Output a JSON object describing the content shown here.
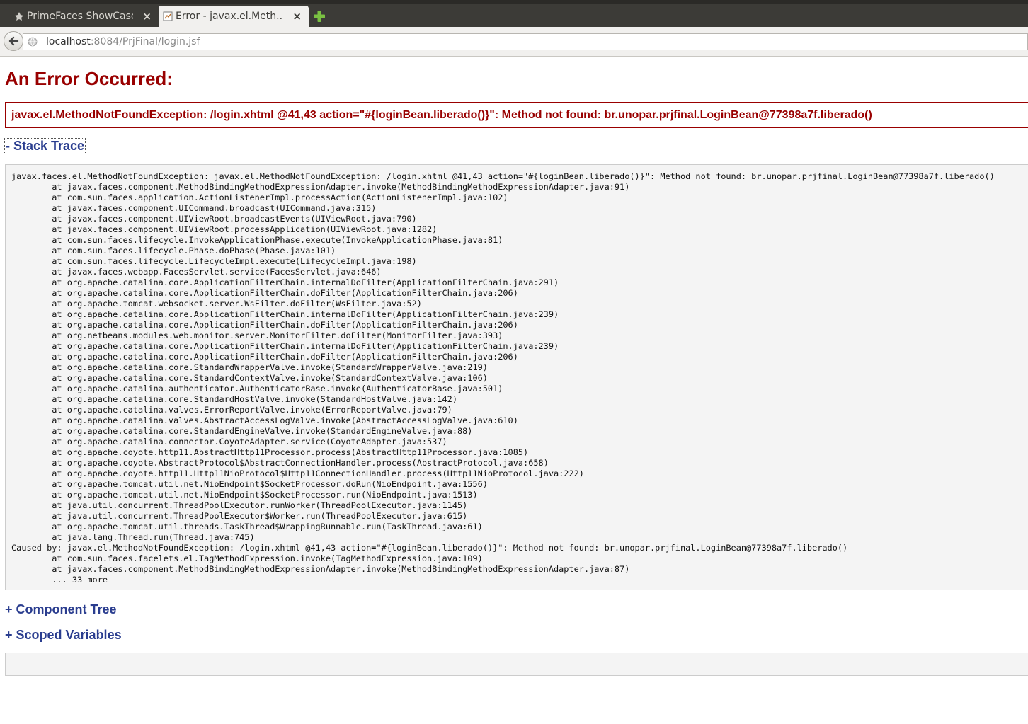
{
  "browser": {
    "tabs": [
      {
        "title": "PrimeFaces ShowCase",
        "close": "×",
        "favicon": "primefaces-icon"
      },
      {
        "title": "Error - javax.el.Meth...",
        "close": "×",
        "favicon": "page-icon"
      }
    ],
    "new_tab_icon": "plus-icon",
    "address": {
      "host": "localhost",
      "rest": ":8084/PrjFinal/login.jsf"
    }
  },
  "page": {
    "heading": "An Error Occurred:",
    "error_message": "javax.el.MethodNotFoundException: /login.xhtml @41,43 action=\"#{loginBean.liberado()}\": Method not found: br.unopar.prjfinal.LoginBean@77398a7f.liberado()",
    "stack_trace_toggle": "- Stack Trace",
    "stack_trace_lines": [
      "javax.faces.el.MethodNotFoundException: javax.el.MethodNotFoundException: /login.xhtml @41,43 action=\"#{loginBean.liberado()}\": Method not found: br.unopar.prjfinal.LoginBean@77398a7f.liberado()",
      "\tat javax.faces.component.MethodBindingMethodExpressionAdapter.invoke(MethodBindingMethodExpressionAdapter.java:91)",
      "\tat com.sun.faces.application.ActionListenerImpl.processAction(ActionListenerImpl.java:102)",
      "\tat javax.faces.component.UICommand.broadcast(UICommand.java:315)",
      "\tat javax.faces.component.UIViewRoot.broadcastEvents(UIViewRoot.java:790)",
      "\tat javax.faces.component.UIViewRoot.processApplication(UIViewRoot.java:1282)",
      "\tat com.sun.faces.lifecycle.InvokeApplicationPhase.execute(InvokeApplicationPhase.java:81)",
      "\tat com.sun.faces.lifecycle.Phase.doPhase(Phase.java:101)",
      "\tat com.sun.faces.lifecycle.LifecycleImpl.execute(LifecycleImpl.java:198)",
      "\tat javax.faces.webapp.FacesServlet.service(FacesServlet.java:646)",
      "\tat org.apache.catalina.core.ApplicationFilterChain.internalDoFilter(ApplicationFilterChain.java:291)",
      "\tat org.apache.catalina.core.ApplicationFilterChain.doFilter(ApplicationFilterChain.java:206)",
      "\tat org.apache.tomcat.websocket.server.WsFilter.doFilter(WsFilter.java:52)",
      "\tat org.apache.catalina.core.ApplicationFilterChain.internalDoFilter(ApplicationFilterChain.java:239)",
      "\tat org.apache.catalina.core.ApplicationFilterChain.doFilter(ApplicationFilterChain.java:206)",
      "\tat org.netbeans.modules.web.monitor.server.MonitorFilter.doFilter(MonitorFilter.java:393)",
      "\tat org.apache.catalina.core.ApplicationFilterChain.internalDoFilter(ApplicationFilterChain.java:239)",
      "\tat org.apache.catalina.core.ApplicationFilterChain.doFilter(ApplicationFilterChain.java:206)",
      "\tat org.apache.catalina.core.StandardWrapperValve.invoke(StandardWrapperValve.java:219)",
      "\tat org.apache.catalina.core.StandardContextValve.invoke(StandardContextValve.java:106)",
      "\tat org.apache.catalina.authenticator.AuthenticatorBase.invoke(AuthenticatorBase.java:501)",
      "\tat org.apache.catalina.core.StandardHostValve.invoke(StandardHostValve.java:142)",
      "\tat org.apache.catalina.valves.ErrorReportValve.invoke(ErrorReportValve.java:79)",
      "\tat org.apache.catalina.valves.AbstractAccessLogValve.invoke(AbstractAccessLogValve.java:610)",
      "\tat org.apache.catalina.core.StandardEngineValve.invoke(StandardEngineValve.java:88)",
      "\tat org.apache.catalina.connector.CoyoteAdapter.service(CoyoteAdapter.java:537)",
      "\tat org.apache.coyote.http11.AbstractHttp11Processor.process(AbstractHttp11Processor.java:1085)",
      "\tat org.apache.coyote.AbstractProtocol$AbstractConnectionHandler.process(AbstractProtocol.java:658)",
      "\tat org.apache.coyote.http11.Http11NioProtocol$Http11ConnectionHandler.process(Http11NioProtocol.java:222)",
      "\tat org.apache.tomcat.util.net.NioEndpoint$SocketProcessor.doRun(NioEndpoint.java:1556)",
      "\tat org.apache.tomcat.util.net.NioEndpoint$SocketProcessor.run(NioEndpoint.java:1513)",
      "\tat java.util.concurrent.ThreadPoolExecutor.runWorker(ThreadPoolExecutor.java:1145)",
      "\tat java.util.concurrent.ThreadPoolExecutor$Worker.run(ThreadPoolExecutor.java:615)",
      "\tat org.apache.tomcat.util.threads.TaskThread$WrappingRunnable.run(TaskThread.java:61)",
      "\tat java.lang.Thread.run(Thread.java:745)",
      "Caused by: javax.el.MethodNotFoundException: /login.xhtml @41,43 action=\"#{loginBean.liberado()}\": Method not found: br.unopar.prjfinal.LoginBean@77398a7f.liberado()",
      "\tat com.sun.faces.facelets.el.TagMethodExpression.invoke(TagMethodExpression.java:109)",
      "\tat javax.faces.component.MethodBindingMethodExpressionAdapter.invoke(MethodBindingMethodExpressionAdapter.java:87)",
      "\t... 33 more"
    ],
    "component_tree_toggle": "+ Component Tree",
    "scoped_variables_toggle": "+ Scoped Variables"
  },
  "colors": {
    "error_red": "#990000",
    "link_blue": "#2a3d8f",
    "tabbar_bg": "#3c3b37"
  }
}
